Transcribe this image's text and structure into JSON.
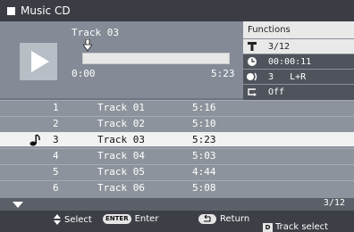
{
  "window": {
    "title": "Music CD"
  },
  "player": {
    "current_track": "Track 03",
    "time_start": "0:00",
    "time_end": "5:23",
    "progress_fraction": 0.03
  },
  "functions": {
    "header": "Functions",
    "rows": [
      {
        "icon": "title-icon",
        "value": "3/12",
        "selected": true
      },
      {
        "icon": "clock-icon",
        "value": "00:00:11",
        "selected": false
      },
      {
        "icon": "audio-icon",
        "value": "3   L+R",
        "selected": false
      },
      {
        "icon": "repeat-icon",
        "value": "Off",
        "selected": false
      }
    ]
  },
  "tracks": [
    {
      "num": "1",
      "name": "Track 01",
      "duration": "5:16",
      "current": false
    },
    {
      "num": "2",
      "name": "Track 02",
      "duration": "5:10",
      "current": false
    },
    {
      "num": "3",
      "name": "Track 03",
      "duration": "5:23",
      "current": true
    },
    {
      "num": "4",
      "name": "Track 04",
      "duration": "5:03",
      "current": false
    },
    {
      "num": "5",
      "name": "Track 05",
      "duration": "4:44",
      "current": false
    },
    {
      "num": "6",
      "name": "Track 06",
      "duration": "5:08",
      "current": false
    }
  ],
  "list_footer": {
    "page": "3/12"
  },
  "hints": {
    "select_label": "Select",
    "enter_button": "ENTER",
    "enter_label": "Enter",
    "return_label": "Return",
    "track_select_key": "D",
    "track_select_label": "Track select"
  },
  "colors": {
    "background": "#6e7480",
    "titlebar": "#3a3d44",
    "highlight": "#f2f2f2"
  }
}
